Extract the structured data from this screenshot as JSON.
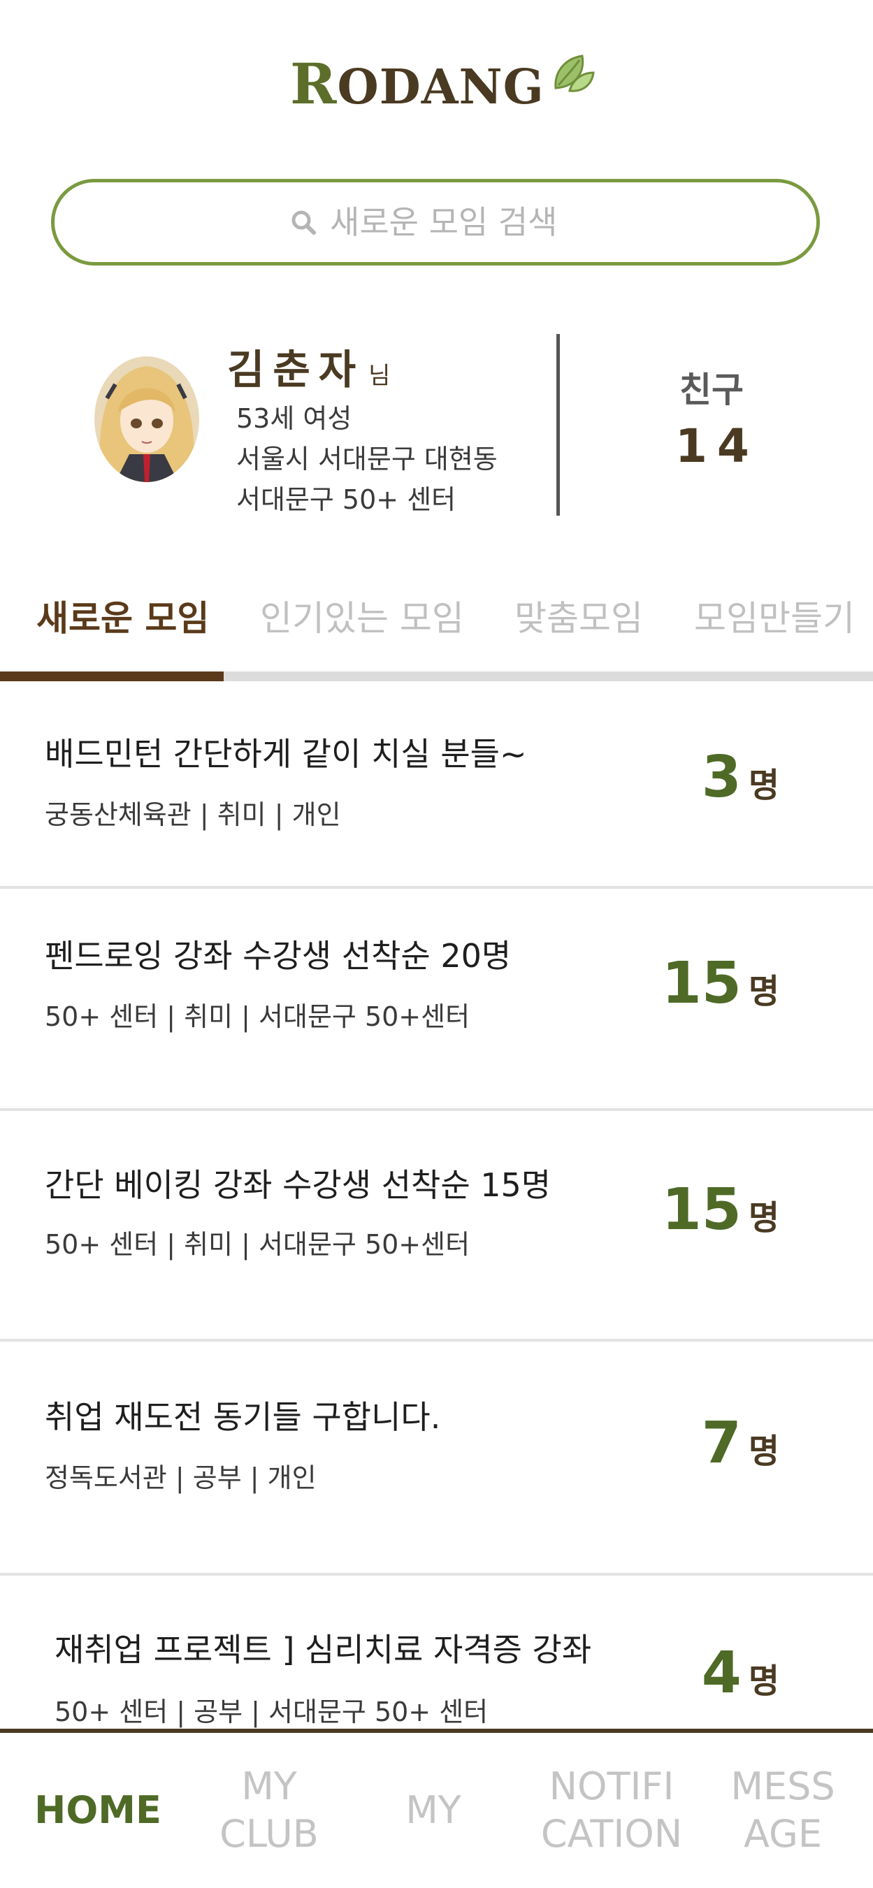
{
  "app": {
    "logo_text": "RODANG",
    "search_placeholder": "새로운 모임 검색"
  },
  "profile": {
    "name": "김춘자",
    "honorific": "님",
    "age_gender": "53세 여성",
    "address": "서울시 서대문구 대현동",
    "center": "서대문구 50+ 센터",
    "friends_label": "친구",
    "friends_count": "14"
  },
  "tabs": [
    {
      "label": "새로운 모임",
      "active": true
    },
    {
      "label": "인기있는 모임",
      "active": false
    },
    {
      "label": "맞춤모임",
      "active": false
    },
    {
      "label": "모임만들기",
      "active": false
    }
  ],
  "items": [
    {
      "title": "배드민턴 간단하게 같이 치실 분들~",
      "meta": "궁동산체육관 | 취미 | 개인",
      "count": "3",
      "unit": "명"
    },
    {
      "title": "펜드로잉 강좌 수강생 선착순 20명",
      "meta": "50+ 센터 | 취미 | 서대문구 50+센터",
      "count": "15",
      "unit": "명"
    },
    {
      "title": "간단 베이킹 강좌 수강생 선착순 15명",
      "meta": "50+ 센터 | 취미 | 서대문구 50+센터",
      "count": "15",
      "unit": "명"
    },
    {
      "title": "취업 재도전 동기들 구합니다.",
      "meta": "정독도서관 | 공부 | 개인",
      "count": "7",
      "unit": "명"
    },
    {
      "title": "재취업 프로젝트 ] 심리치료 자격증 강좌",
      "meta": "50+ 센터 | 공부 | 서대문구 50+ 센터",
      "count": "4",
      "unit": "명"
    }
  ],
  "nav": [
    {
      "label": "HOME",
      "active": true
    },
    {
      "label": "MY CLUB",
      "active": false
    },
    {
      "label": "MY",
      "active": false
    },
    {
      "label": "NOTIFI CATION",
      "active": false
    },
    {
      "label": "MESS AGE",
      "active": false
    }
  ],
  "colors": {
    "accent_green": "#4e6a26",
    "search_border": "#7a9a3f",
    "brown": "#4a3a22"
  }
}
